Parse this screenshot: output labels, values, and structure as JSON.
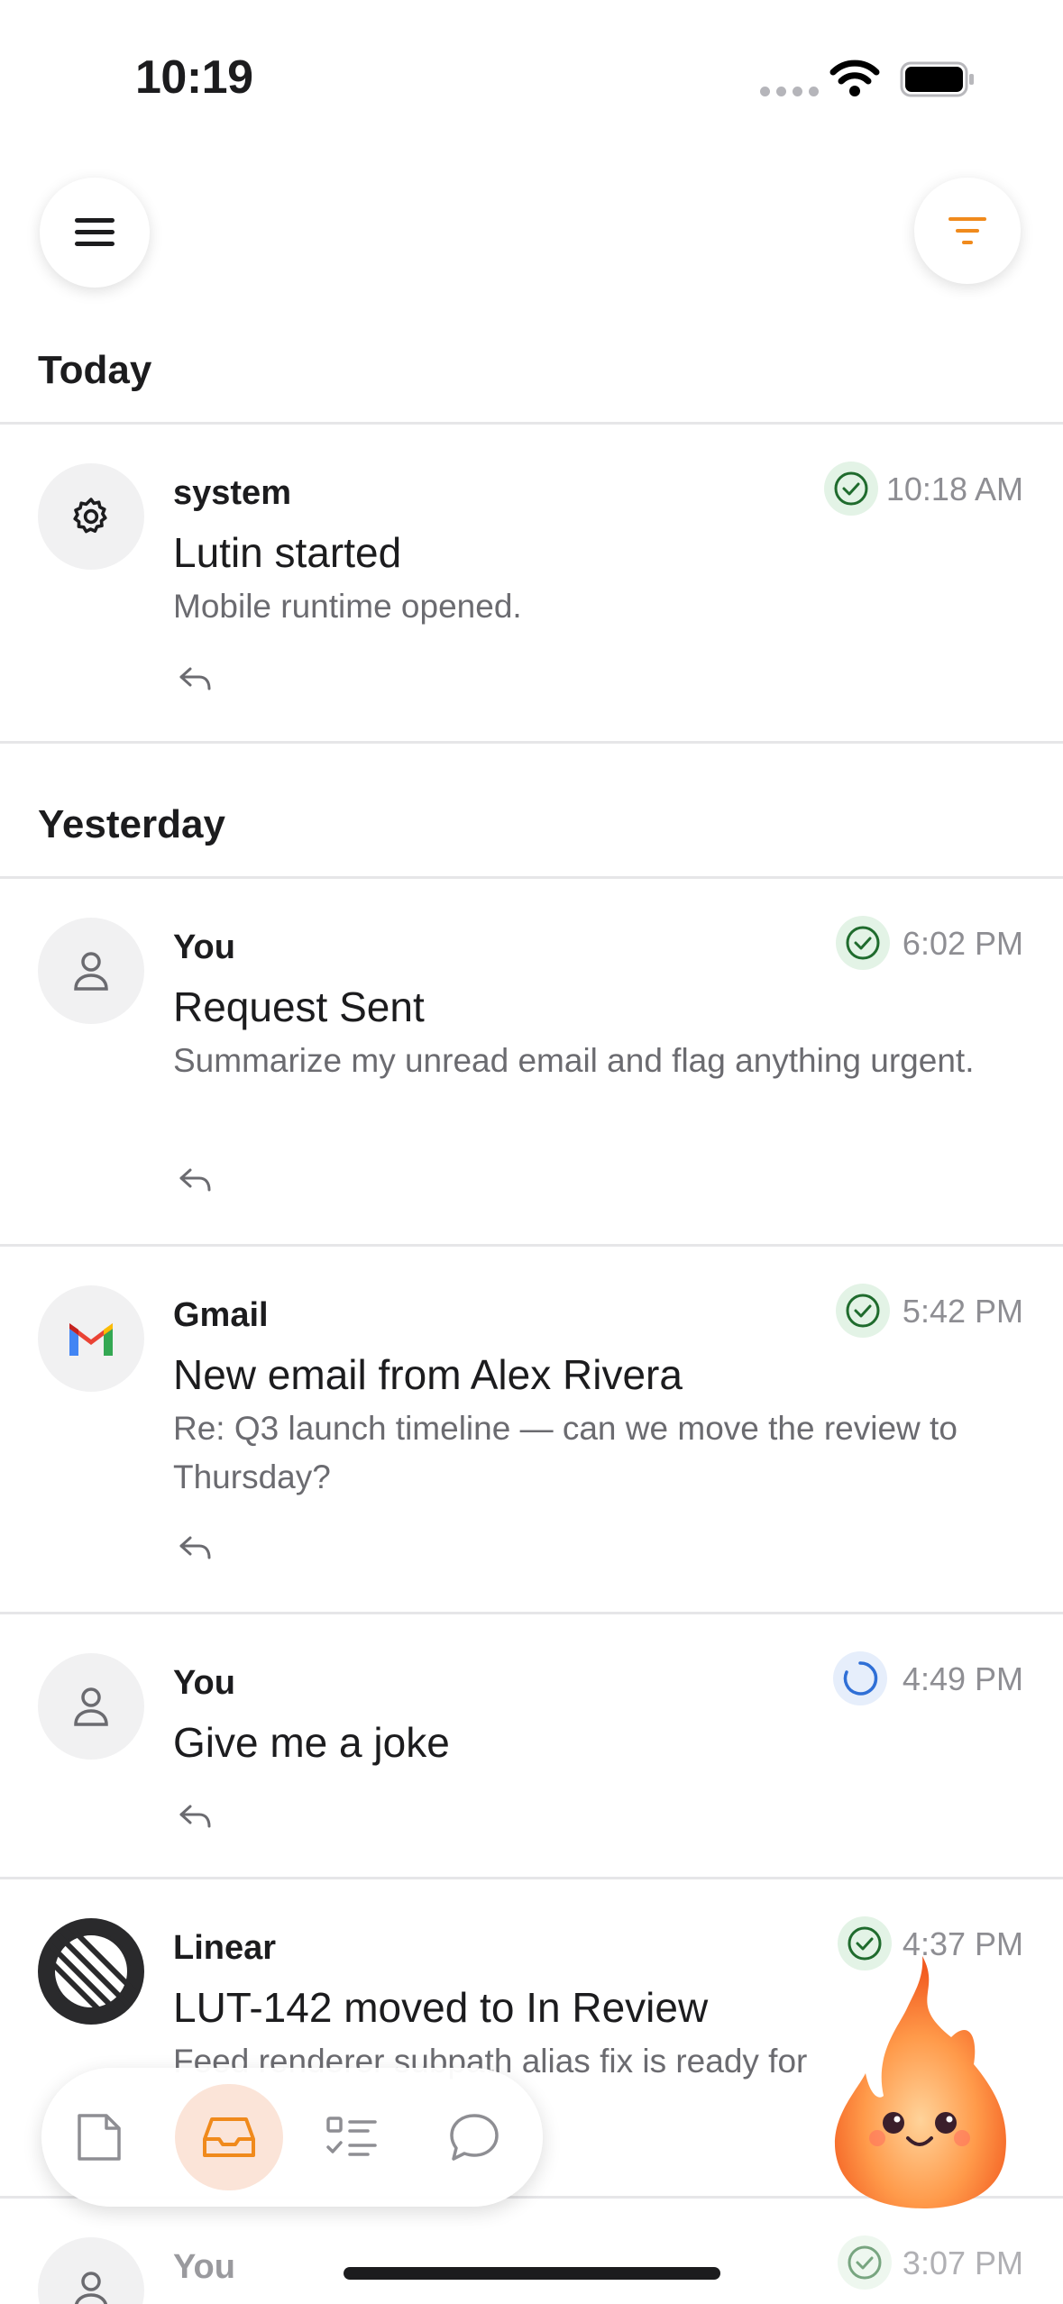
{
  "status_bar": {
    "time": "10:19"
  },
  "colors": {
    "accent": "#f08a1c",
    "done": "#2e7d3a",
    "pending": "#2f6fd6"
  },
  "sections": {
    "today": "Today",
    "yesterday": "Yesterday"
  },
  "items": [
    {
      "avatar": "gear-icon",
      "source": "system",
      "title": "Lutin started",
      "body": "Mobile runtime opened.",
      "status": "done",
      "time": "10:18 AM"
    },
    {
      "avatar": "person-icon",
      "source": "You",
      "title": "Request Sent",
      "body": "Summarize my unread email and flag anything urgent.",
      "status": "done",
      "time": "6:02 PM"
    },
    {
      "avatar": "gmail-logo",
      "source": "Gmail",
      "title": "New email from Alex Rivera",
      "body": "Re: Q3 launch timeline — can we move the review to Thursday?",
      "status": "done",
      "time": "5:42 PM"
    },
    {
      "avatar": "person-icon",
      "source": "You",
      "title": "Give me a joke",
      "body": "",
      "status": "pending",
      "time": "4:49 PM"
    },
    {
      "avatar": "linear-logo",
      "source": "Linear",
      "title": "LUT-142 moved to In Review",
      "body": "Feed renderer subpath alias fix is ready for",
      "status": "done",
      "time": "4:37 PM"
    },
    {
      "avatar": "person-icon",
      "source": "You",
      "title": "",
      "body": "",
      "status": "done",
      "time": "3:07 PM"
    }
  ],
  "bottom_nav": [
    "document-icon",
    "inbox-icon",
    "tasks-icon",
    "chat-icon"
  ]
}
